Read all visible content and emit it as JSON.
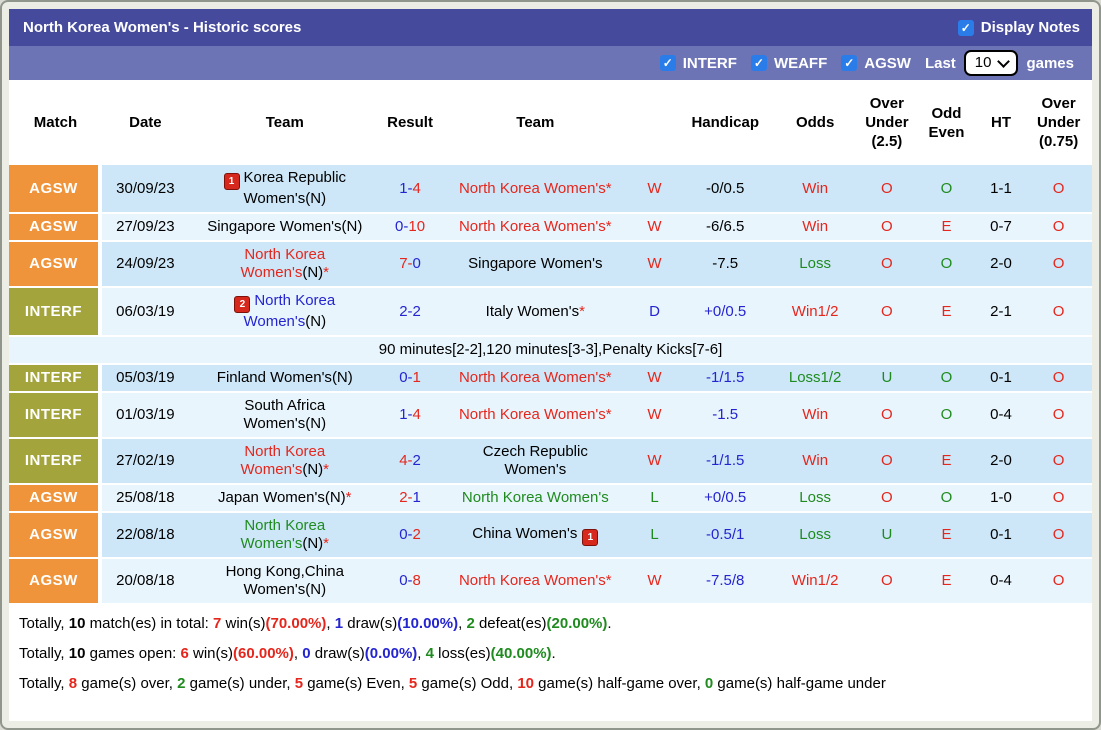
{
  "palette": {
    "red": "#e5261c",
    "blue": "#2424d0",
    "green": "#1f8b1f",
    "black": "#000000",
    "bar1": "#454a9d",
    "bar2": "#6c74b6",
    "checkbox_blue": "#2a7de9",
    "row_alt": [
      "#cde7f8",
      "#e9f5fd"
    ],
    "league_colors": {
      "AGSW": "#f0943c",
      "INTERF": "#a3a43c"
    }
  },
  "icons": {
    "check": "✓"
  },
  "header": {
    "title": "North Korea Women's - Historic scores",
    "display_notes": "Display Notes",
    "filters": [
      {
        "label": "INTERF",
        "checked": true
      },
      {
        "label": "WEAFF",
        "checked": true
      },
      {
        "label": "AGSW",
        "checked": true
      }
    ],
    "last_label": "Last",
    "last_value": "10",
    "games_label": "games"
  },
  "columns": [
    "Match",
    "Date",
    "Team",
    "Result",
    "Team",
    "",
    "Handicap",
    "Odds",
    "Over Under (2.5)",
    "Odd Even",
    "HT",
    "Over Under (0.75)"
  ],
  "rows": [
    {
      "league": "AGSW",
      "date": "30/09/23",
      "home": {
        "name": "Korea Republic Women's",
        "n": true,
        "color": "black",
        "card": "1",
        "card_pos": "before"
      },
      "score": {
        "h": "1",
        "a": "4",
        "hc": "blue",
        "ac": "red"
      },
      "away": {
        "name": "North Korea Women's",
        "color": "red",
        "star": true
      },
      "wdl": {
        "t": "W",
        "c": "red"
      },
      "handicap": {
        "t": "-0/0.5",
        "c": "black"
      },
      "odds": {
        "t": "Win",
        "c": "red"
      },
      "over_under_25": {
        "t": "O",
        "c": "red"
      },
      "odd_even": {
        "t": "O",
        "c": "green"
      },
      "ht": "1-1",
      "over_under_075": {
        "t": "O",
        "c": "red"
      }
    },
    {
      "league": "AGSW",
      "date": "27/09/23",
      "home": {
        "name": "Singapore Women's",
        "n": true,
        "color": "black"
      },
      "score": {
        "h": "0",
        "a": "10",
        "hc": "blue",
        "ac": "red"
      },
      "away": {
        "name": "North Korea Women's",
        "color": "red",
        "star": true
      },
      "wdl": {
        "t": "W",
        "c": "red"
      },
      "handicap": {
        "t": "-6/6.5",
        "c": "black"
      },
      "odds": {
        "t": "Win",
        "c": "red"
      },
      "over_under_25": {
        "t": "O",
        "c": "red"
      },
      "odd_even": {
        "t": "E",
        "c": "red"
      },
      "ht": "0-7",
      "over_under_075": {
        "t": "O",
        "c": "red"
      }
    },
    {
      "league": "AGSW",
      "date": "24/09/23",
      "home": {
        "name": "North Korea Women's",
        "n": true,
        "color": "red",
        "star": true
      },
      "score": {
        "h": "7",
        "a": "0",
        "hc": "red",
        "ac": "blue"
      },
      "away": {
        "name": "Singapore Women's",
        "color": "black"
      },
      "wdl": {
        "t": "W",
        "c": "red"
      },
      "handicap": {
        "t": "-7.5",
        "c": "black"
      },
      "odds": {
        "t": "Loss",
        "c": "green"
      },
      "over_under_25": {
        "t": "O",
        "c": "red"
      },
      "odd_even": {
        "t": "O",
        "c": "green"
      },
      "ht": "2-0",
      "over_under_075": {
        "t": "O",
        "c": "red"
      }
    },
    {
      "league": "INTERF",
      "date": "06/03/19",
      "home": {
        "name": "North Korea Women's",
        "n": true,
        "color": "blue",
        "card": "2",
        "card_pos": "before"
      },
      "score": {
        "h": "2",
        "a": "2",
        "hc": "blue",
        "ac": "blue"
      },
      "away": {
        "name": "Italy Women's",
        "color": "black",
        "star": true
      },
      "wdl": {
        "t": "D",
        "c": "blue"
      },
      "handicap": {
        "t": "+0/0.5",
        "c": "blue"
      },
      "odds": {
        "t": "Win1/2",
        "c": "red"
      },
      "over_under_25": {
        "t": "O",
        "c": "red"
      },
      "odd_even": {
        "t": "E",
        "c": "red"
      },
      "ht": "2-1",
      "over_under_075": {
        "t": "O",
        "c": "red"
      },
      "note": "90 minutes[2-2],120 minutes[3-3],Penalty Kicks[7-6]"
    },
    {
      "league": "INTERF",
      "date": "05/03/19",
      "home": {
        "name": "Finland Women's",
        "n": true,
        "color": "black"
      },
      "score": {
        "h": "0",
        "a": "1",
        "hc": "blue",
        "ac": "red"
      },
      "away": {
        "name": "North Korea Women's",
        "color": "red",
        "star": true
      },
      "wdl": {
        "t": "W",
        "c": "red"
      },
      "handicap": {
        "t": "-1/1.5",
        "c": "blue"
      },
      "odds": {
        "t": "Loss1/2",
        "c": "green"
      },
      "over_under_25": {
        "t": "U",
        "c": "green"
      },
      "odd_even": {
        "t": "O",
        "c": "green"
      },
      "ht": "0-1",
      "over_under_075": {
        "t": "O",
        "c": "red"
      }
    },
    {
      "league": "INTERF",
      "date": "01/03/19",
      "home": {
        "name": "South Africa Women's",
        "n": true,
        "color": "black"
      },
      "score": {
        "h": "1",
        "a": "4",
        "hc": "blue",
        "ac": "red"
      },
      "away": {
        "name": "North Korea Women's",
        "color": "red",
        "star": true
      },
      "wdl": {
        "t": "W",
        "c": "red"
      },
      "handicap": {
        "t": "-1.5",
        "c": "blue"
      },
      "odds": {
        "t": "Win",
        "c": "red"
      },
      "over_under_25": {
        "t": "O",
        "c": "red"
      },
      "odd_even": {
        "t": "O",
        "c": "green"
      },
      "ht": "0-4",
      "over_under_075": {
        "t": "O",
        "c": "red"
      }
    },
    {
      "league": "INTERF",
      "date": "27/02/19",
      "home": {
        "name": "North Korea Women's",
        "n": true,
        "color": "red",
        "star": true
      },
      "score": {
        "h": "4",
        "a": "2",
        "hc": "red",
        "ac": "blue"
      },
      "away": {
        "name": "Czech Republic Women's",
        "color": "black"
      },
      "wdl": {
        "t": "W",
        "c": "red"
      },
      "handicap": {
        "t": "-1/1.5",
        "c": "blue"
      },
      "odds": {
        "t": "Win",
        "c": "red"
      },
      "over_under_25": {
        "t": "O",
        "c": "red"
      },
      "odd_even": {
        "t": "E",
        "c": "red"
      },
      "ht": "2-0",
      "over_under_075": {
        "t": "O",
        "c": "red"
      }
    },
    {
      "league": "AGSW",
      "date": "25/08/18",
      "home": {
        "name": "Japan Women's",
        "n": true,
        "color": "black",
        "star": true
      },
      "score": {
        "h": "2",
        "a": "1",
        "hc": "red",
        "ac": "blue"
      },
      "away": {
        "name": "North Korea Women's",
        "color": "green"
      },
      "wdl": {
        "t": "L",
        "c": "green"
      },
      "handicap": {
        "t": "+0/0.5",
        "c": "blue"
      },
      "odds": {
        "t": "Loss",
        "c": "green"
      },
      "over_under_25": {
        "t": "O",
        "c": "red"
      },
      "odd_even": {
        "t": "O",
        "c": "green"
      },
      "ht": "1-0",
      "over_under_075": {
        "t": "O",
        "c": "red"
      }
    },
    {
      "league": "AGSW",
      "date": "22/08/18",
      "home": {
        "name": "North Korea Women's",
        "n": true,
        "color": "green",
        "star": true
      },
      "score": {
        "h": "0",
        "a": "2",
        "hc": "blue",
        "ac": "red"
      },
      "away": {
        "name": "China Women's",
        "color": "black",
        "card": "1",
        "card_pos": "after"
      },
      "wdl": {
        "t": "L",
        "c": "green"
      },
      "handicap": {
        "t": "-0.5/1",
        "c": "blue"
      },
      "odds": {
        "t": "Loss",
        "c": "green"
      },
      "over_under_25": {
        "t": "U",
        "c": "green"
      },
      "odd_even": {
        "t": "E",
        "c": "red"
      },
      "ht": "0-1",
      "over_under_075": {
        "t": "O",
        "c": "red"
      }
    },
    {
      "league": "AGSW",
      "date": "20/08/18",
      "home": {
        "name": "Hong Kong,China Women's",
        "n": true,
        "color": "black"
      },
      "score": {
        "h": "0",
        "a": "8",
        "hc": "blue",
        "ac": "red"
      },
      "away": {
        "name": "North Korea Women's",
        "color": "red",
        "star": true
      },
      "wdl": {
        "t": "W",
        "c": "red"
      },
      "handicap": {
        "t": "-7.5/8",
        "c": "blue"
      },
      "odds": {
        "t": "Win1/2",
        "c": "red"
      },
      "over_under_25": {
        "t": "O",
        "c": "red"
      },
      "odd_even": {
        "t": "E",
        "c": "red"
      },
      "ht": "0-4",
      "over_under_075": {
        "t": "O",
        "c": "red"
      }
    }
  ],
  "summary": [
    [
      {
        "t": "Totally, "
      },
      {
        "t": "10",
        "b": 1
      },
      {
        "t": " match(es) in total: "
      },
      {
        "t": "7",
        "c": "red",
        "b": 1
      },
      {
        "t": " win(s)"
      },
      {
        "t": "(70.00%)",
        "c": "red",
        "b": 1
      },
      {
        "t": ", "
      },
      {
        "t": "1",
        "c": "blue",
        "b": 1
      },
      {
        "t": " draw(s)"
      },
      {
        "t": "(10.00%)",
        "c": "blue",
        "b": 1
      },
      {
        "t": ", "
      },
      {
        "t": "2",
        "c": "green",
        "b": 1
      },
      {
        "t": " defeat(es)"
      },
      {
        "t": "(20.00%)",
        "c": "green",
        "b": 1
      },
      {
        "t": "."
      }
    ],
    [
      {
        "t": "Totally, "
      },
      {
        "t": "10",
        "b": 1
      },
      {
        "t": " games open: "
      },
      {
        "t": "6",
        "c": "red",
        "b": 1
      },
      {
        "t": " win(s)"
      },
      {
        "t": "(60.00%)",
        "c": "red",
        "b": 1
      },
      {
        "t": ", "
      },
      {
        "t": "0",
        "c": "blue",
        "b": 1
      },
      {
        "t": " draw(s)"
      },
      {
        "t": "(0.00%)",
        "c": "blue",
        "b": 1
      },
      {
        "t": ", "
      },
      {
        "t": "4",
        "c": "green",
        "b": 1
      },
      {
        "t": " loss(es)"
      },
      {
        "t": "(40.00%)",
        "c": "green",
        "b": 1
      },
      {
        "t": "."
      }
    ],
    [
      {
        "t": "Totally, "
      },
      {
        "t": "8",
        "c": "red",
        "b": 1
      },
      {
        "t": " game(s) over, "
      },
      {
        "t": "2",
        "c": "green",
        "b": 1
      },
      {
        "t": " game(s) under, "
      },
      {
        "t": "5",
        "c": "red",
        "b": 1
      },
      {
        "t": " game(s) Even, "
      },
      {
        "t": "5",
        "c": "red",
        "b": 1
      },
      {
        "t": " game(s) Odd, "
      },
      {
        "t": "10",
        "c": "red",
        "b": 1
      },
      {
        "t": " game(s) half-game over, "
      },
      {
        "t": "0",
        "c": "green",
        "b": 1
      },
      {
        "t": " game(s) half-game under"
      }
    ]
  ]
}
